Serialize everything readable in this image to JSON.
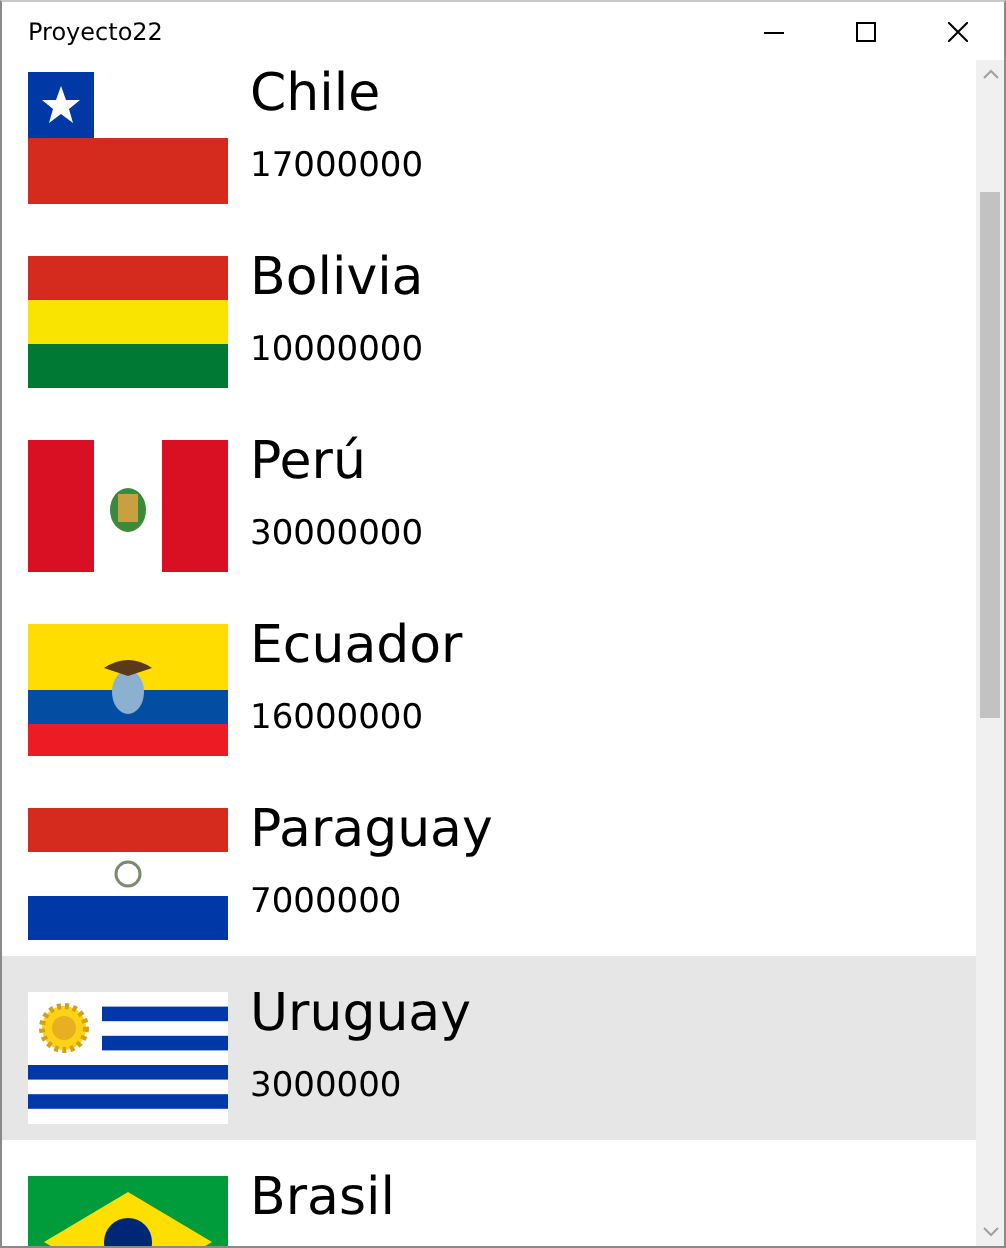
{
  "window": {
    "title": "Proyecto22"
  },
  "countries": [
    {
      "name": "Chile",
      "population": "17000000",
      "kind": "chile",
      "selected": false
    },
    {
      "name": "Bolivia",
      "population": "10000000",
      "kind": "bolivia",
      "selected": false
    },
    {
      "name": "Perú",
      "population": "30000000",
      "kind": "peru",
      "selected": false
    },
    {
      "name": "Ecuador",
      "population": "16000000",
      "kind": "ecuador",
      "selected": false
    },
    {
      "name": "Paraguay",
      "population": "7000000",
      "kind": "paraguay",
      "selected": false
    },
    {
      "name": "Uruguay",
      "population": "3000000",
      "kind": "uruguay",
      "selected": true
    },
    {
      "name": "Brasil",
      "kind": "brasil",
      "selected": false
    }
  ]
}
